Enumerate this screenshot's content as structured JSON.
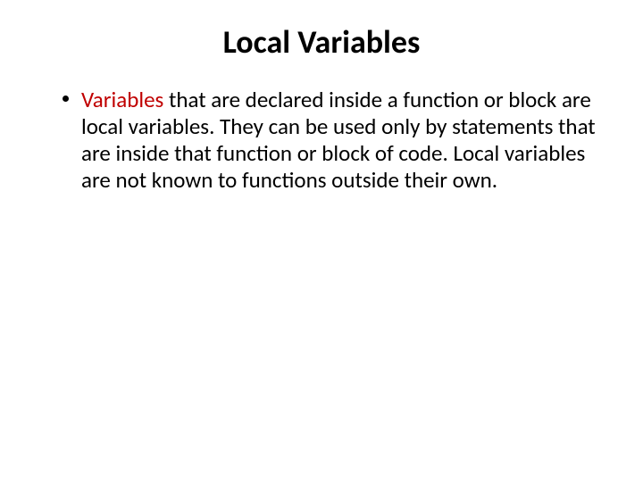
{
  "slide": {
    "title": "Local Variables",
    "bullet": {
      "keyword": "Variables",
      "rest": " that are declared inside a function or block are local variables. They can be used only by statements that are inside that function or block of code. Local variables are not known to functions outside their own."
    }
  },
  "colors": {
    "keyword": "#c00000",
    "text": "#000000",
    "background": "#ffffff"
  }
}
